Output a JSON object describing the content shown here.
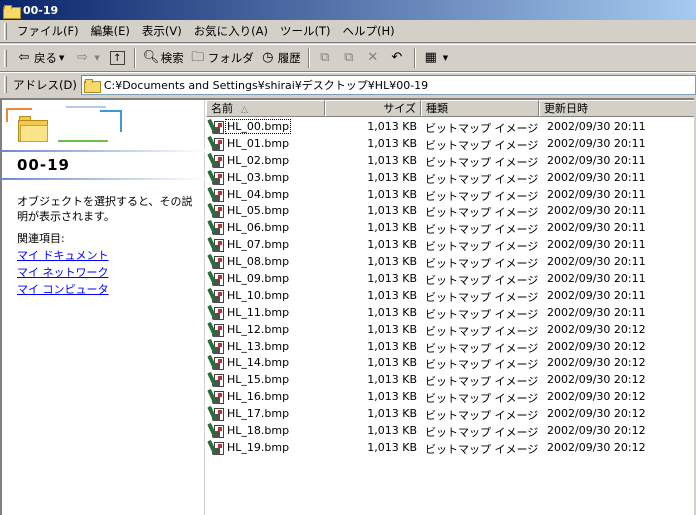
{
  "window": {
    "title": "00-19"
  },
  "menu": [
    "ファイル(F)",
    "編集(E)",
    "表示(V)",
    "お気に入り(A)",
    "ツール(T)",
    "ヘルプ(H)"
  ],
  "toolbar": {
    "back": "戻る",
    "search": "検索",
    "folders": "フォルダ",
    "history": "履歴"
  },
  "address": {
    "label": "アドレス(D)",
    "path": "C:¥Documents and Settings¥shirai¥デスクトップ¥HL¥00-19"
  },
  "leftpane": {
    "title": "00-19",
    "description": "オブジェクトを選択すると、その説明が表示されます。",
    "related_label": "関連項目:",
    "links": [
      "マイ ドキュメント",
      "マイ ネットワーク",
      "マイ コンピュータ"
    ]
  },
  "columns": {
    "name": "名前",
    "size": "サイズ",
    "type": "種類",
    "date": "更新日時"
  },
  "files": [
    {
      "name": "HL_00.bmp",
      "size": "1,013 KB",
      "type": "ビットマップ イメージ",
      "date": "2002/09/30 20:11"
    },
    {
      "name": "HL_01.bmp",
      "size": "1,013 KB",
      "type": "ビットマップ イメージ",
      "date": "2002/09/30 20:11"
    },
    {
      "name": "HL_02.bmp",
      "size": "1,013 KB",
      "type": "ビットマップ イメージ",
      "date": "2002/09/30 20:11"
    },
    {
      "name": "HL_03.bmp",
      "size": "1,013 KB",
      "type": "ビットマップ イメージ",
      "date": "2002/09/30 20:11"
    },
    {
      "name": "HL_04.bmp",
      "size": "1,013 KB",
      "type": "ビットマップ イメージ",
      "date": "2002/09/30 20:11"
    },
    {
      "name": "HL_05.bmp",
      "size": "1,013 KB",
      "type": "ビットマップ イメージ",
      "date": "2002/09/30 20:11"
    },
    {
      "name": "HL_06.bmp",
      "size": "1,013 KB",
      "type": "ビットマップ イメージ",
      "date": "2002/09/30 20:11"
    },
    {
      "name": "HL_07.bmp",
      "size": "1,013 KB",
      "type": "ビットマップ イメージ",
      "date": "2002/09/30 20:11"
    },
    {
      "name": "HL_08.bmp",
      "size": "1,013 KB",
      "type": "ビットマップ イメージ",
      "date": "2002/09/30 20:11"
    },
    {
      "name": "HL_09.bmp",
      "size": "1,013 KB",
      "type": "ビットマップ イメージ",
      "date": "2002/09/30 20:11"
    },
    {
      "name": "HL_10.bmp",
      "size": "1,013 KB",
      "type": "ビットマップ イメージ",
      "date": "2002/09/30 20:11"
    },
    {
      "name": "HL_11.bmp",
      "size": "1,013 KB",
      "type": "ビットマップ イメージ",
      "date": "2002/09/30 20:11"
    },
    {
      "name": "HL_12.bmp",
      "size": "1,013 KB",
      "type": "ビットマップ イメージ",
      "date": "2002/09/30 20:12"
    },
    {
      "name": "HL_13.bmp",
      "size": "1,013 KB",
      "type": "ビットマップ イメージ",
      "date": "2002/09/30 20:12"
    },
    {
      "name": "HL_14.bmp",
      "size": "1,013 KB",
      "type": "ビットマップ イメージ",
      "date": "2002/09/30 20:12"
    },
    {
      "name": "HL_15.bmp",
      "size": "1,013 KB",
      "type": "ビットマップ イメージ",
      "date": "2002/09/30 20:12"
    },
    {
      "name": "HL_16.bmp",
      "size": "1,013 KB",
      "type": "ビットマップ イメージ",
      "date": "2002/09/30 20:12"
    },
    {
      "name": "HL_17.bmp",
      "size": "1,013 KB",
      "type": "ビットマップ イメージ",
      "date": "2002/09/30 20:12"
    },
    {
      "name": "HL_18.bmp",
      "size": "1,013 KB",
      "type": "ビットマップ イメージ",
      "date": "2002/09/30 20:12"
    },
    {
      "name": "HL_19.bmp",
      "size": "1,013 KB",
      "type": "ビットマップ イメージ",
      "date": "2002/09/30 20:12"
    }
  ]
}
